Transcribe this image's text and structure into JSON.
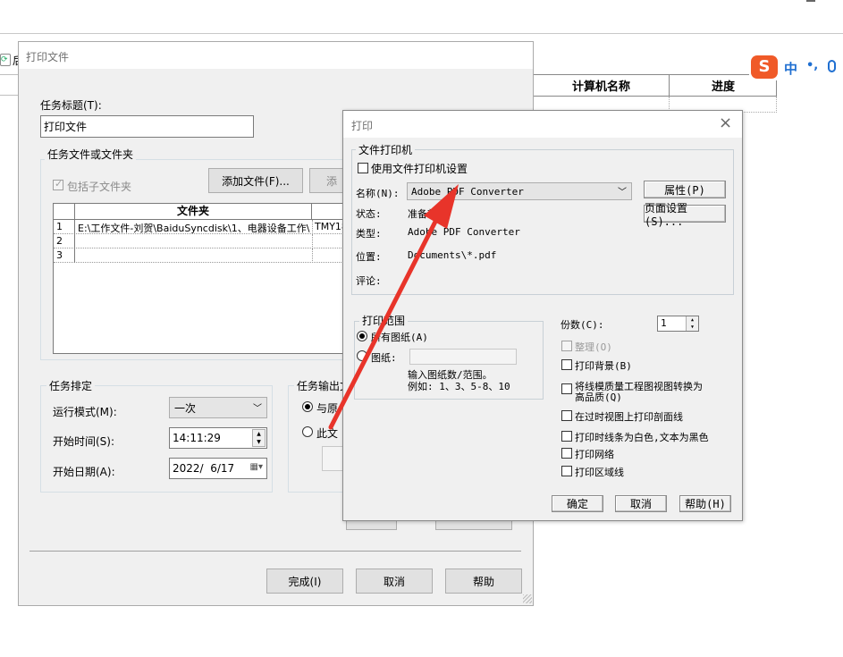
{
  "bg_table": {
    "col1": "计算机名称",
    "col2": "进度"
  },
  "toolbar_partial": "后",
  "ime": {
    "lang": "中",
    "punct": "•,",
    "logo": "S"
  },
  "task_dialog": {
    "title": "打印文件",
    "task_title_label": "任务标题(T):",
    "task_title_value": "打印文件",
    "files_group": "任务文件或文件夹",
    "include_subfolders": "包括子文件夹",
    "add_file_btn": "添加文件(F)...",
    "add_folder_btn_partial": "添",
    "table": {
      "header": "文件夹",
      "rows": [
        {
          "num": "1",
          "path": "E:\\工作文件-刘贺\\BaiduSyncdisk\\1、电器设备工作\\",
          "extra": "TMY18"
        },
        {
          "num": "2",
          "path": "",
          "extra": ""
        },
        {
          "num": "3",
          "path": "",
          "extra": ""
        }
      ]
    },
    "schedule_group": "任务排定",
    "run_mode_label": "运行模式(M):",
    "run_mode_value": "一次",
    "start_time_label": "开始时间(S):",
    "start_time_value": "14:11:29",
    "start_date_label": "开始日期(A):",
    "start_date_value": "2022/  6/17",
    "output_group_partial": "任务输出文",
    "output_opt1_partial": "与原",
    "output_opt2_partial": "此文",
    "finish_btn": "完成(I)",
    "cancel_btn": "取消",
    "help_btn": "帮助"
  },
  "print_dialog": {
    "title": "打印",
    "printer_group": "文件打印机",
    "use_printer_settings": "使用文件打印机设置",
    "name_label": "名称(N):",
    "name_value": "Adobe PDF Converter",
    "properties_btn": "属性(P)",
    "page_setup_btn": "页面设置(S)...",
    "status_label": "状态:",
    "status_value": "准备就绪",
    "type_label": "类型:",
    "type_value": "Adobe PDF Converter",
    "location_label": "位置:",
    "location_value": "Documents\\*.pdf",
    "comment_label": "评论:",
    "range_group": "打印范围",
    "all_sheets": "所有图纸(A)",
    "sheets": "图纸:",
    "range_hint1": "输入图纸数/范围。",
    "range_hint2": "例如: 1、3、5-8、10",
    "copies_label": "份数(C):",
    "copies_value": "1",
    "collate": "整理(O)",
    "print_background": "打印背景(B)",
    "convert_wireframe_1": "将线模质量工程图视图转换为",
    "convert_wireframe_2": "高品质(Q)",
    "print_section_lines": "在过时视图上打印剖面线",
    "print_lines_white": "打印时线条为白色,文本为黑色",
    "print_grid": "打印网络",
    "print_area_lines": "打印区域线",
    "ok_btn": "确定",
    "cancel_btn": "取消",
    "help_btn": "帮助(H)"
  },
  "colors": {
    "annotation_arrow": "#e8342a",
    "ime_brand": "#f05a28",
    "ime_blue": "#1f6fd1"
  }
}
